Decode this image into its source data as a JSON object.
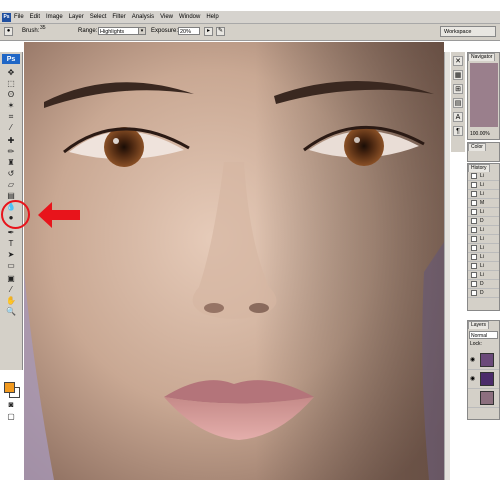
{
  "menu": {
    "logo": "Ps",
    "items": [
      "File",
      "Edit",
      "Image",
      "Layer",
      "Select",
      "Filter",
      "Analysis",
      "View",
      "Window",
      "Help"
    ]
  },
  "options": {
    "brush_label": "Brush:",
    "brush_size": "35",
    "range_label": "Range:",
    "range_value": "Highlights",
    "exposure_label": "Exposure:",
    "exposure_value": "20%",
    "workspace_label": "Workspace"
  },
  "toolbox": {
    "logo": "Ps",
    "foreground_color": "#f29a1f",
    "background_color": "#ffffff",
    "selected_tool": "dodge-tool"
  },
  "panels": {
    "navigator_tab": "Navigator",
    "zoom_value": "100.00%",
    "color_tab": "Color",
    "history_tab": "History",
    "history_items": [
      "Li",
      "Li",
      "Li",
      "M",
      "Li",
      "D",
      "Li",
      "Li",
      "Li",
      "Li",
      "Li",
      "Li",
      "D",
      "D"
    ],
    "layers_tab": "Layers",
    "blend_mode": "Normal",
    "lock_label": "Lock:"
  },
  "annotation": {
    "circle_color": "#e8141b",
    "arrow_color": "#e8141b"
  }
}
